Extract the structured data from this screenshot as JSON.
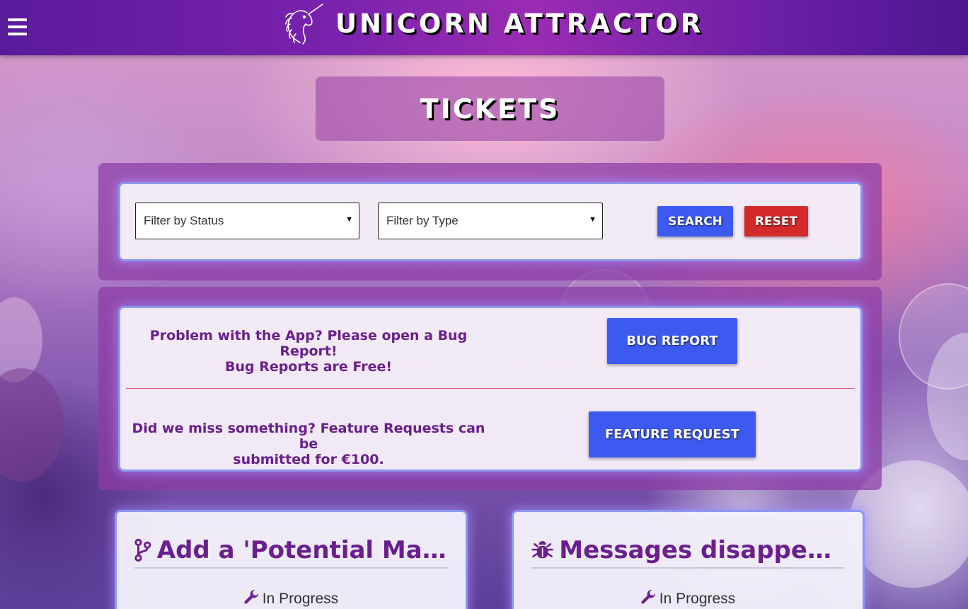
{
  "header": {
    "menu_icon": "hamburger-menu-icon",
    "logo_icon": "unicorn-logo-icon",
    "app_title": "UNICORN ATTRACTOR"
  },
  "page": {
    "title": "TICKETS"
  },
  "filters": {
    "status_placeholder": "Filter by Status",
    "type_placeholder": "Filter by Type",
    "search_label": "SEARCH",
    "reset_label": "RESET"
  },
  "promos": {
    "bug": {
      "line1": "Problem with the App? Please open a Bug Report!",
      "line2": "Bug Reports are Free!",
      "button_label": "BUG REPORT"
    },
    "feature": {
      "line1": "Did we miss something? Feature Requests can be",
      "line2": "submitted for €100.",
      "button_label": "FEATURE REQUEST"
    }
  },
  "tickets": [
    {
      "icon": "branch-icon",
      "title": "Add a 'Potential Matc...",
      "status_icon": "wrench-icon",
      "status": "In Progress"
    },
    {
      "icon": "bug-icon",
      "title": "Messages disappearin...",
      "status_icon": "wrench-icon",
      "status": "In Progress"
    }
  ],
  "colors": {
    "header": "#7a22ad",
    "accent_purple": "#6a1f8e",
    "button_blue": "#3d5af0",
    "button_red": "#d42a2a",
    "card_border": "#8d97f0",
    "divider": "#d9587c"
  }
}
